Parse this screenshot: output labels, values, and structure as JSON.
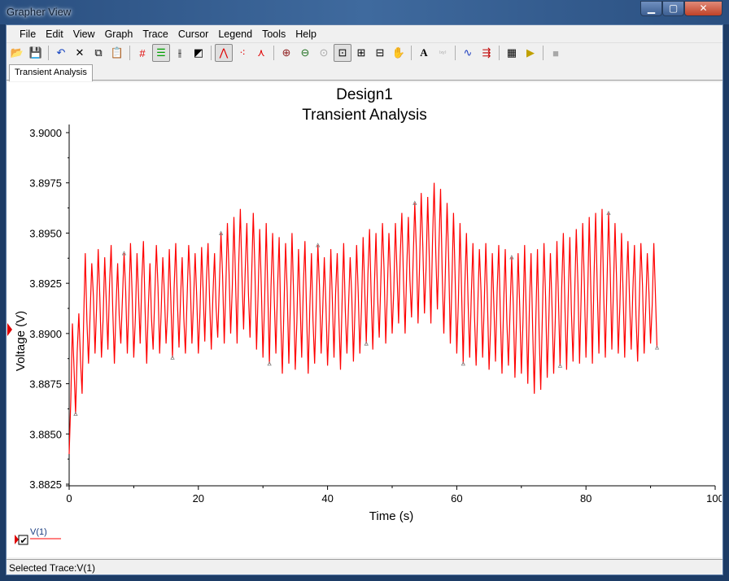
{
  "window": {
    "title": "Grapher View",
    "controls": [
      "minimize",
      "maximize",
      "close"
    ]
  },
  "menu": [
    "File",
    "Edit",
    "View",
    "Graph",
    "Trace",
    "Cursor",
    "Legend",
    "Tools",
    "Help"
  ],
  "toolbar": [
    {
      "icon": "open-folder-icon",
      "glyph": "📂"
    },
    {
      "icon": "save-icon",
      "glyph": "💾"
    },
    {
      "sep": true
    },
    {
      "icon": "undo-icon",
      "glyph": "↶",
      "color": "#1040c0"
    },
    {
      "icon": "delete-icon",
      "glyph": "✕"
    },
    {
      "icon": "copy-icon",
      "glyph": "⧉"
    },
    {
      "icon": "paste-icon",
      "glyph": "📋",
      "disabled": true
    },
    {
      "sep": true
    },
    {
      "icon": "grid-icon",
      "glyph": "#",
      "color": "#e00000"
    },
    {
      "icon": "legend-icon",
      "glyph": "☰",
      "color": "#00a000",
      "active": true
    },
    {
      "icon": "cursors-icon",
      "glyph": "⫲"
    },
    {
      "icon": "reverse-colors-icon",
      "glyph": "◩"
    },
    {
      "sep": true
    },
    {
      "icon": "lines-icon",
      "glyph": "⋀",
      "color": "#e00000",
      "active": true
    },
    {
      "icon": "points-icon",
      "glyph": "⁖",
      "color": "#e00000"
    },
    {
      "icon": "lines-points-icon",
      "glyph": "⋏",
      "color": "#e00000"
    },
    {
      "sep": true
    },
    {
      "icon": "zoom-in-icon",
      "glyph": "⊕",
      "color": "#902020"
    },
    {
      "icon": "zoom-out-icon",
      "glyph": "⊖",
      "color": "#207020"
    },
    {
      "icon": "zoom-full-icon",
      "glyph": "⊙",
      "disabled": true
    },
    {
      "icon": "zoom-area-icon",
      "glyph": "⊡",
      "active": true
    },
    {
      "icon": "zoom-x-icon",
      "glyph": "⊞"
    },
    {
      "icon": "zoom-y-icon",
      "glyph": "⊟"
    },
    {
      "icon": "pan-hand-icon",
      "glyph": "✋"
    },
    {
      "sep": true
    },
    {
      "icon": "text-icon",
      "glyph": "A"
    },
    {
      "icon": "xy-label-icon",
      "glyph": "⁽ˣʸ⁾",
      "disabled": true
    },
    {
      "sep": true
    },
    {
      "icon": "trace-properties-icon",
      "glyph": "∿",
      "color": "#2040c0"
    },
    {
      "icon": "add-trace-icon",
      "glyph": "⇶",
      "color": "#c00000"
    },
    {
      "sep": true
    },
    {
      "icon": "export-excel-icon",
      "glyph": "▦"
    },
    {
      "icon": "export-ni-icon",
      "glyph": "▶",
      "color": "#c0a000"
    },
    {
      "sep": true
    },
    {
      "icon": "stop-icon",
      "glyph": "■",
      "disabled": true
    }
  ],
  "tabs": [
    {
      "label": "Transient Analysis",
      "active": true
    }
  ],
  "chart_data": {
    "type": "line",
    "title": "Design1",
    "subtitle": "Transient Analysis",
    "xlabel": "Time (s)",
    "ylabel": "Voltage (V)",
    "xlim": [
      0,
      100
    ],
    "ylim": [
      3.8825,
      3.9
    ],
    "xticks": [
      "0",
      "20",
      "40",
      "60",
      "80",
      "100"
    ],
    "yticks": [
      "3.8825",
      "3.8850",
      "3.8875",
      "3.8900",
      "3.8925",
      "3.8950",
      "3.8975",
      "3.9000"
    ],
    "grid": false,
    "legend": "bottom-left",
    "series": [
      {
        "name": "V(1)",
        "color": "#ff0000",
        "x_start": 0,
        "x_step": 0.5,
        "y": [
          3.884,
          3.8905,
          3.886,
          3.891,
          3.887,
          3.894,
          3.8885,
          3.8935,
          3.889,
          3.8942,
          3.8888,
          3.8938,
          3.8892,
          3.8944,
          3.8885,
          3.8935,
          3.8895,
          3.894,
          3.889,
          3.8945,
          3.8888,
          3.894,
          3.8895,
          3.8946,
          3.8885,
          3.8935,
          3.8892,
          3.8944,
          3.889,
          3.8938,
          3.8895,
          3.8942,
          3.8888,
          3.8945,
          3.8893,
          3.8938,
          3.889,
          3.8944,
          3.8895,
          3.894,
          3.889,
          3.8943,
          3.8896,
          3.8945,
          3.8892,
          3.894,
          3.8898,
          3.895,
          3.8895,
          3.8955,
          3.89,
          3.8958,
          3.8895,
          3.8962,
          3.8902,
          3.8955,
          3.8898,
          3.896,
          3.8892,
          3.8952,
          3.8888,
          3.8955,
          3.8885,
          3.895,
          3.889,
          3.8948,
          3.888,
          3.8945,
          3.8885,
          3.895,
          3.8882,
          3.8942,
          3.8888,
          3.8946,
          3.888,
          3.894,
          3.8885,
          3.8944,
          3.889,
          3.8938,
          3.8884,
          3.8942,
          3.8888,
          3.894,
          3.8882,
          3.8945,
          3.889,
          3.8938,
          3.8886,
          3.8944,
          3.889,
          3.8948,
          3.8895,
          3.8952,
          3.8892,
          3.895,
          3.8898,
          3.8955,
          3.8895,
          3.895,
          3.89,
          3.8955,
          3.8905,
          3.896,
          3.89,
          3.8958,
          3.8908,
          3.8965,
          3.8905,
          3.897,
          3.891,
          3.8968,
          3.8905,
          3.8975,
          3.8912,
          3.8972,
          3.89,
          3.8965,
          3.8895,
          3.896,
          3.889,
          3.8955,
          3.8885,
          3.895,
          3.8888,
          3.8945,
          3.8884,
          3.8942,
          3.8888,
          3.8945,
          3.8882,
          3.894,
          3.8886,
          3.8944,
          3.888,
          3.8942,
          3.8884,
          3.8938,
          3.8878,
          3.894,
          3.888,
          3.8944,
          3.8875,
          3.894,
          3.887,
          3.8942,
          3.8872,
          3.8945,
          3.8878,
          3.894,
          3.888,
          3.8946,
          3.8884,
          3.895,
          3.8882,
          3.8948,
          3.8886,
          3.8952,
          3.8885,
          3.8955,
          3.8888,
          3.8958,
          3.8885,
          3.896,
          3.889,
          3.8962,
          3.8888,
          3.896,
          3.8892,
          3.8955,
          3.889,
          3.895,
          3.8888,
          3.8946,
          3.8892,
          3.8944,
          3.8886,
          3.8945,
          3.889,
          3.894,
          3.8895,
          3.8945,
          3.8893
        ]
      }
    ]
  },
  "legend": {
    "entries": [
      {
        "label": "V(1)",
        "checked": true,
        "color": "#ff0000"
      }
    ]
  },
  "status": {
    "text": "Selected Trace:V(1)"
  }
}
